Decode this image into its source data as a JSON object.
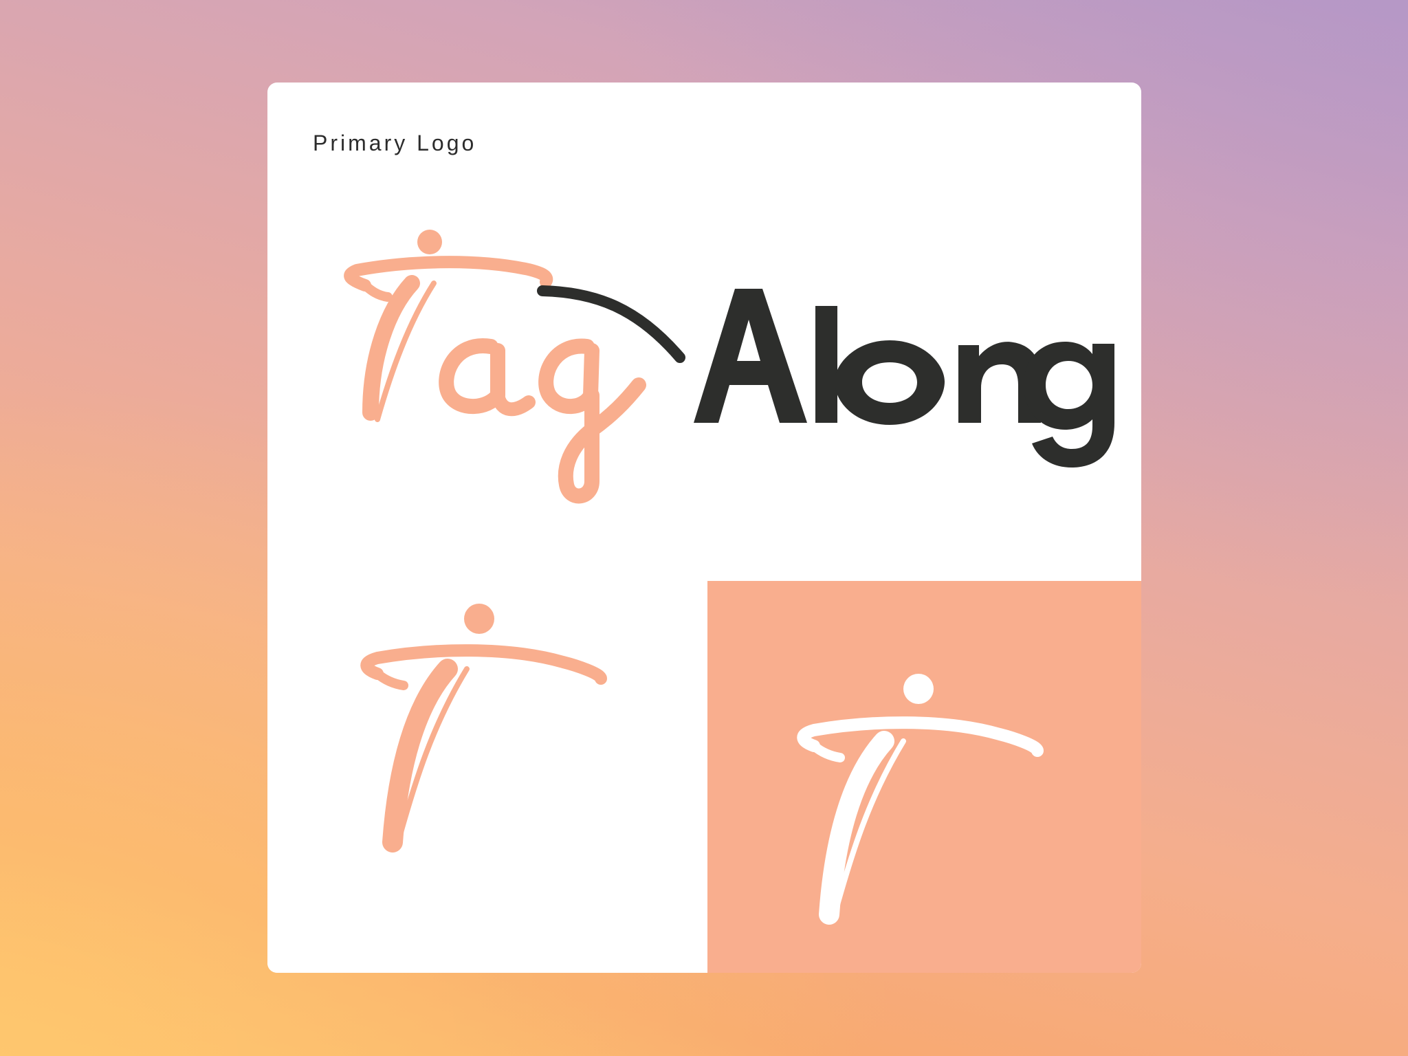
{
  "card": {
    "label": "Primary Logo"
  },
  "logo": {
    "wordmark_script": "Tag",
    "wordmark_bold": "Along",
    "icon_name": "person-t-icon"
  },
  "colors": {
    "peach": "#f9ae8e",
    "charcoal": "#2d2e2c",
    "white": "#ffffff"
  }
}
